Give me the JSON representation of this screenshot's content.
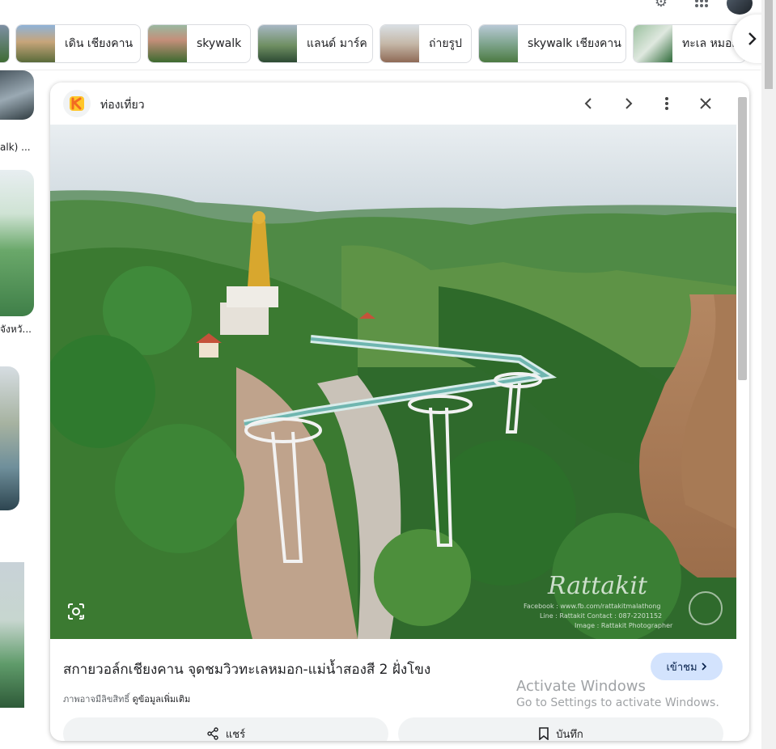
{
  "chips": [
    {
      "label": "",
      "color_a": "#7d8fa3",
      "color_b": "#3f6c34"
    },
    {
      "label": "เดิน เชียงคาน",
      "color_a": "#8fb3d8",
      "color_b": "#5a6b3a"
    },
    {
      "label": "skywalk",
      "color_a": "#7ea0a8",
      "color_b": "#3d6a2f"
    },
    {
      "label": "แลนด์ มาร์ค",
      "color_a": "#a7b7c4",
      "color_b": "#587a4a"
    },
    {
      "label": "ถ่ายรูป",
      "color_a": "#d9dfe3",
      "color_b": "#8f6a56"
    },
    {
      "label": "skywalk เชียงคาน",
      "color_a": "#b9c9d6",
      "color_b": "#4c7a42"
    },
    {
      "label": "ทะเล หมอก",
      "color_a": "#9cc1a0",
      "color_b": "#2f6b3a"
    }
  ],
  "left_column": {
    "caption_1": "alk) ...",
    "caption_2": "จังหวั..."
  },
  "panel": {
    "site_name": "ท่องเที่ยว",
    "title": "สกายวอล์กเชียงคาน จุดชมวิวทะเลหมอก-แม่น้ำสองสี 2 ฝั่งโขง",
    "visit_label": "เข้าชม",
    "copyright_text": "ภาพอาจมีลิขสิทธิ์",
    "learn_more": "ดูข้อมูลเพิ่มเติม",
    "share_label": "แชร์",
    "save_label": "บันทึก",
    "watermark": {
      "line1": "Rattakit",
      "line2": "Facebook : www.fb.com/rattakitmalathong",
      "line3": "Line : Rattakit   Contact : 087-2201152",
      "line4": "Image : Rattakit Photographer"
    }
  },
  "overlay": {
    "activate_title": "Activate Windows",
    "activate_sub": "Go to Settings to activate Windows."
  },
  "colors": {
    "accent_chip": "#d3e3fd",
    "logo_orange": "#f26a21",
    "logo_yellow": "#ffc629"
  }
}
